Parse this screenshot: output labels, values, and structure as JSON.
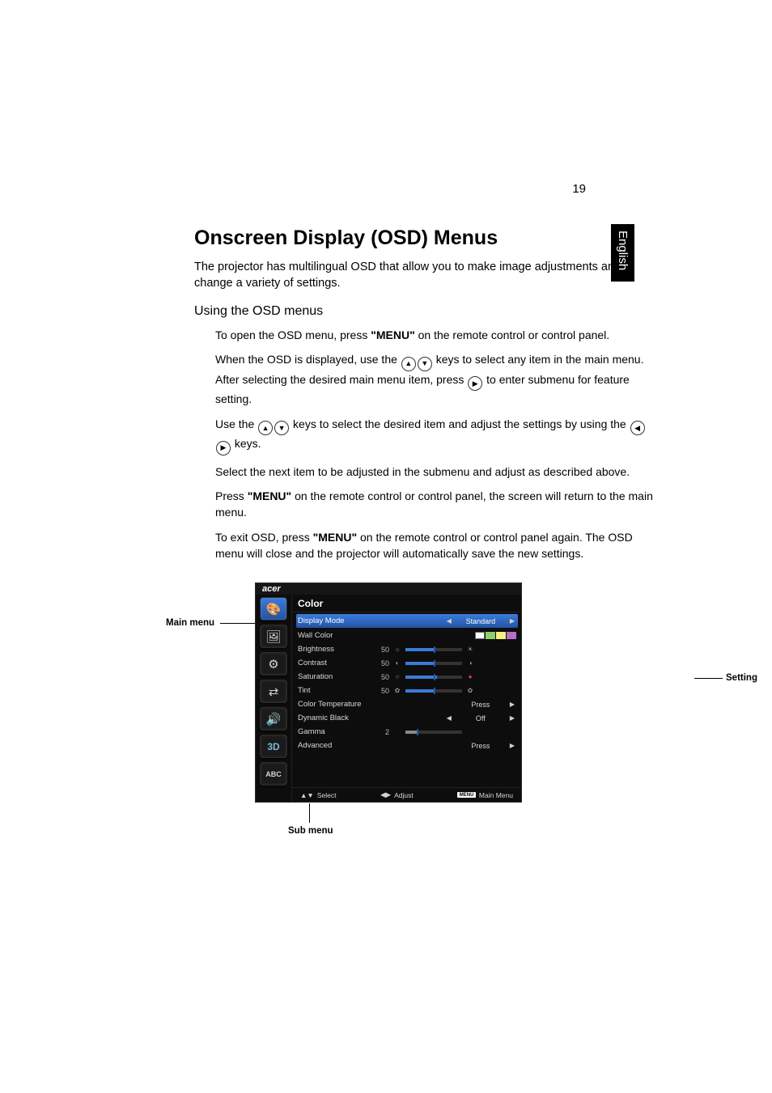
{
  "page_number": "19",
  "language_tab": "English",
  "heading": "Onscreen Display (OSD) Menus",
  "intro": "The projector has multilingual OSD that allow you to make image adjustments and change a variety of settings.",
  "subheading": "Using the OSD menus",
  "steps": {
    "s1a": "To open the OSD menu, press ",
    "s1b": "\"MENU\"",
    "s1c": " on the remote control or control panel.",
    "s2a": "When the OSD is displayed, use the ",
    "s2b": " keys to select any item in the main menu. After selecting the desired main menu item, press ",
    "s2c": " to enter submenu for feature setting.",
    "s3a": "Use the ",
    "s3b": " keys to select the desired item and adjust the settings by using the ",
    "s3c": " keys.",
    "s4": "Select the next item to be adjusted in the submenu and adjust as described above.",
    "s5a": "Press ",
    "s5b": "\"MENU\"",
    "s5c": " on the remote control or control panel, the screen will return to the main menu.",
    "s6a": "To exit OSD, press ",
    "s6b": "\"MENU\"",
    "s6c": " on the remote control or control panel again. The OSD menu will close and the projector will automatically save the new settings."
  },
  "callouts": {
    "main_menu": "Main menu",
    "setting": "Setting",
    "sub_menu": "Sub menu"
  },
  "osd": {
    "brand": "acer",
    "title": "Color",
    "rows": {
      "display_mode": {
        "label": "Display Mode",
        "value": "Standard"
      },
      "wall_color": {
        "label": "Wall Color"
      },
      "brightness": {
        "label": "Brightness",
        "value": "50"
      },
      "contrast": {
        "label": "Contrast",
        "value": "50"
      },
      "saturation": {
        "label": "Saturation",
        "value": "50"
      },
      "tint": {
        "label": "Tint",
        "value": "50"
      },
      "color_temp": {
        "label": "Color Temperature",
        "value": "Press"
      },
      "dynamic_black": {
        "label": "Dynamic Black",
        "value": "Off"
      },
      "gamma": {
        "label": "Gamma",
        "value": "2"
      },
      "advanced": {
        "label": "Advanced",
        "value": "Press"
      }
    },
    "footer": {
      "select": "Select",
      "adjust": "Adjust",
      "menu_btn": "MENU",
      "main_menu": "Main Menu"
    },
    "side_labels": {
      "abc": "ABC",
      "threed": "3D"
    }
  }
}
